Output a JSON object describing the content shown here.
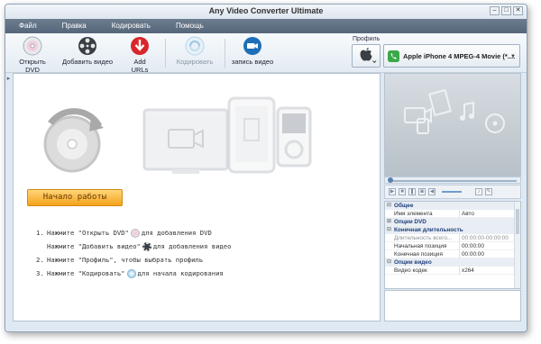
{
  "window": {
    "title": "Any Video Converter Ultimate",
    "minimize": "–",
    "maximize": "□",
    "close": "✕"
  },
  "menu": [
    "Файл",
    "Правка",
    "Кодировать",
    "Помощь"
  ],
  "toolbar": {
    "open_dvd": "Открыть DVD",
    "add_video": "Добавить видео",
    "add_urls": "Add URLs",
    "encode": "Кодировать",
    "record_video": "запись видео"
  },
  "profile": {
    "label": "Профиль",
    "selected": "Apple iPhone 4 MPEG-4 Movie (*...."
  },
  "main": {
    "start_button": "Начало работы",
    "steps": [
      {
        "num": "1.",
        "before": "Нажмите \"Открыть DVD\"",
        "after": " для добавления DVD"
      },
      {
        "num": "",
        "before": "Нажмите \"Добавить видео\"",
        "after": " для добавления видео"
      },
      {
        "num": "2.",
        "before": "Нажмите \"Профиль\", чтобы выбрать профиль",
        "after": ""
      },
      {
        "num": "3.",
        "before": "Нажмите \"Кодировать\"",
        "after": " для начала кодирования"
      }
    ]
  },
  "properties": {
    "cat_general": "Общее",
    "item_name_label": "Имя элемента",
    "item_name_value": "Авто",
    "cat_dvd": "Опции DVD",
    "cat_duration": "Конечная длительность",
    "total_duration_label": "Длительность всего...",
    "total_duration_value": "00:00:00-00:00:00",
    "start_pos_label": "Начальная позиция",
    "start_pos_value": "00:00:00",
    "end_pos_label": "Конечная позиция",
    "end_pos_value": "00:00:00",
    "cat_video": "Опции видео",
    "video_codec_label": "Видео кодек",
    "video_codec_value": "x264",
    "expand": "⊟",
    "collapse": "⊞"
  },
  "colors": {
    "menubar": "#5f6f82",
    "start_button": "#f7b02b",
    "category_text": "#1f3f7a"
  }
}
